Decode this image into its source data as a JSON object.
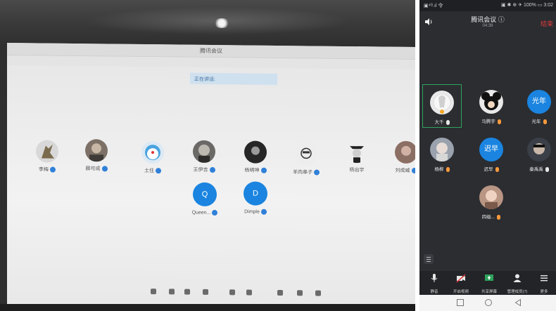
{
  "photo": {
    "window_title": "腾讯会议",
    "speaking_label": "正在讲话:",
    "participants_row1": [
      {
        "name": "李梅",
        "type": "photo"
      },
      {
        "name": "薛可成",
        "type": "photo"
      },
      {
        "name": "土住",
        "type": "photo"
      },
      {
        "name": "王伊吉",
        "type": "photo"
      },
      {
        "name": "杨明坤",
        "type": "photo"
      },
      {
        "name": "羊肉串子",
        "type": "photo"
      },
      {
        "name": "杨出宇",
        "type": "photo"
      },
      {
        "name": "刘成威",
        "type": "photo"
      }
    ],
    "participants_row2": [
      {
        "name": "Queen...",
        "initial": "Q"
      },
      {
        "name": "Dimple",
        "initial": "D"
      }
    ]
  },
  "phone": {
    "status": {
      "left": "▣⁴ᴳ.ıl 令",
      "right": "▣ ✱ ⊕ ✈ 100% ▭ 3:02"
    },
    "header": {
      "title": "腾讯会议 ⓘ",
      "time": "04:38",
      "end_label": "结束"
    },
    "participants": [
      {
        "name": "大千",
        "avatar": "photo"
      },
      {
        "name": "马腾宇",
        "avatar": "photo"
      },
      {
        "name": "光年",
        "avatar": "blue",
        "initials": "光年"
      },
      {
        "name": "杨柳",
        "avatar": "photo"
      },
      {
        "name": "迟早",
        "avatar": "blue",
        "initials": "迟早"
      },
      {
        "name": "秦禹禹",
        "avatar": "photo"
      },
      {
        "name": "四级...",
        "avatar": "photo"
      }
    ],
    "toolbar": [
      {
        "label": "静音",
        "icon": "microphone-icon"
      },
      {
        "label": "开启视频",
        "icon": "video-off-icon"
      },
      {
        "label": "共享屏幕",
        "icon": "share-screen-icon"
      },
      {
        "label": "管理成员(7)",
        "icon": "members-icon"
      },
      {
        "label": "更多",
        "icon": "more-icon"
      }
    ],
    "nav": [
      "square-icon",
      "circle-icon",
      "triangle-back-icon"
    ],
    "colors": {
      "accent": "#1a84e0",
      "end": "#e23a3a",
      "active_border": "#2fa35c",
      "mic": "#ff9a3c"
    }
  }
}
